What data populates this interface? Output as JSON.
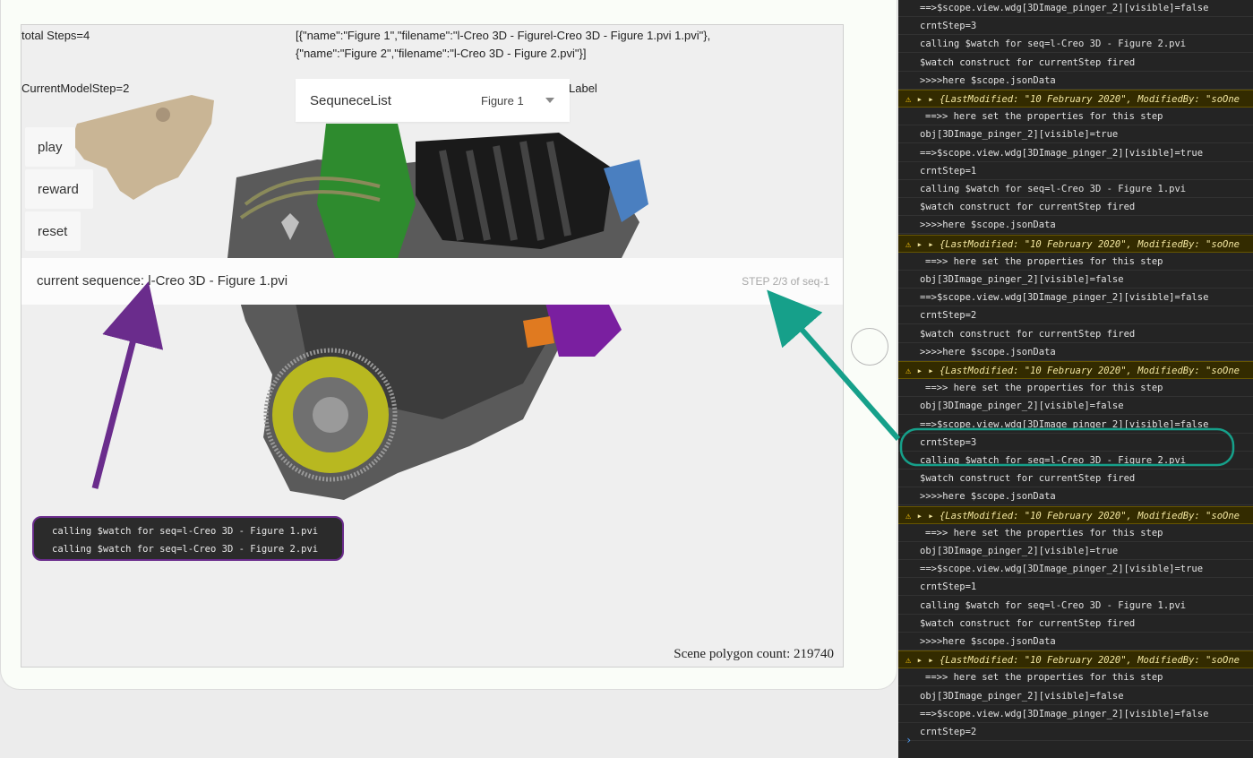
{
  "app": {
    "total_steps": "total Steps=4",
    "current_model_step": "CurrentModelStep=2",
    "json_text": "[{\"name\":\"Figure 1\",\"filename\":\"l-Creo 3D - Figurel-Creo 3D - Figure 1.pvi 1.pvi\"},{\"name\":\"Figure 2\",\"filename\":\"l-Creo 3D - Figure 2.pvi\"}]",
    "label": "Label",
    "sequence_list": {
      "title": "SequneceList",
      "selected": "Figure 1"
    },
    "buttons": {
      "play": "play",
      "reward": "reward",
      "reset": "reset"
    },
    "current_sequence": "current sequence: l-Creo 3D - Figure 1.pvi",
    "step_label": "STEP 2/3 of seq-1",
    "mini_console": [
      "calling $watch for seq=l-Creo 3D - Figure 1.pvi",
      "calling $watch for seq=l-Creo 3D - Figure 2.pvi"
    ],
    "polygon_count": "Scene polygon count: 219740"
  },
  "console": {
    "warn_text": "{LastModified: \"10 February 2020\", ModifiedBy: \"soOne",
    "lines": [
      {
        "text": "==>$scope.view.wdg[3DImage_pinger_2][visible]=false",
        "kind": "log"
      },
      {
        "text": "crntStep=3",
        "kind": "log"
      },
      {
        "text": "calling $watch for seq=l-Creo 3D - Figure 2.pvi",
        "kind": "log"
      },
      {
        "text": "$watch construct for currentStep fired",
        "kind": "log"
      },
      {
        "text": ">>>>here $scope.jsonData",
        "kind": "log"
      },
      {
        "text": "warn",
        "kind": "warn"
      },
      {
        "text": "==>> here set the properties for this step",
        "kind": "indent"
      },
      {
        "text": "obj[3DImage_pinger_2][visible]=true",
        "kind": "log"
      },
      {
        "text": "==>$scope.view.wdg[3DImage_pinger_2][visible]=true",
        "kind": "log"
      },
      {
        "text": "crntStep=1",
        "kind": "log"
      },
      {
        "text": "calling $watch for seq=l-Creo 3D - Figure 1.pvi",
        "kind": "log"
      },
      {
        "text": "$watch construct for currentStep fired",
        "kind": "log"
      },
      {
        "text": ">>>>here $scope.jsonData",
        "kind": "log"
      },
      {
        "text": "warn",
        "kind": "warn"
      },
      {
        "text": "==>> here set the properties for this step",
        "kind": "indent"
      },
      {
        "text": "obj[3DImage_pinger_2][visible]=false",
        "kind": "log"
      },
      {
        "text": "==>$scope.view.wdg[3DImage_pinger_2][visible]=false",
        "kind": "log"
      },
      {
        "text": "crntStep=2",
        "kind": "log"
      },
      {
        "text": "$watch construct for currentStep fired",
        "kind": "log"
      },
      {
        "text": ">>>>here $scope.jsonData",
        "kind": "log"
      },
      {
        "text": "warn",
        "kind": "warn"
      },
      {
        "text": "==>> here set the properties for this step",
        "kind": "indent"
      },
      {
        "text": "obj[3DImage_pinger_2][visible]=false",
        "kind": "log"
      },
      {
        "text": "==>$scope.view.wdg[3DImage_pinger_2][visible]=false",
        "kind": "log"
      },
      {
        "text": "crntStep=3",
        "kind": "log"
      },
      {
        "text": "calling $watch for seq=l-Creo 3D - Figure 2.pvi",
        "kind": "log"
      },
      {
        "text": "$watch construct for currentStep fired",
        "kind": "log"
      },
      {
        "text": ">>>>here $scope.jsonData",
        "kind": "log"
      },
      {
        "text": "warn",
        "kind": "warn"
      },
      {
        "text": "==>> here set the properties for this step",
        "kind": "indent"
      },
      {
        "text": "obj[3DImage_pinger_2][visible]=true",
        "kind": "log"
      },
      {
        "text": "==>$scope.view.wdg[3DImage_pinger_2][visible]=true",
        "kind": "log"
      },
      {
        "text": "crntStep=1",
        "kind": "log"
      },
      {
        "text": "calling $watch for seq=l-Creo 3D - Figure 1.pvi",
        "kind": "log"
      },
      {
        "text": "$watch construct for currentStep fired",
        "kind": "log"
      },
      {
        "text": ">>>>here $scope.jsonData",
        "kind": "log"
      },
      {
        "text": "warn",
        "kind": "warn"
      },
      {
        "text": "==>> here set the properties for this step",
        "kind": "indent"
      },
      {
        "text": "obj[3DImage_pinger_2][visible]=false",
        "kind": "log"
      },
      {
        "text": "==>$scope.view.wdg[3DImage_pinger_2][visible]=false",
        "kind": "log"
      },
      {
        "text": "crntStep=2",
        "kind": "log"
      }
    ],
    "prompt": "›"
  },
  "colors": {
    "annotation_purple": "#6a2c8c",
    "annotation_teal": "#16a08a",
    "console_bg": "#242424"
  }
}
